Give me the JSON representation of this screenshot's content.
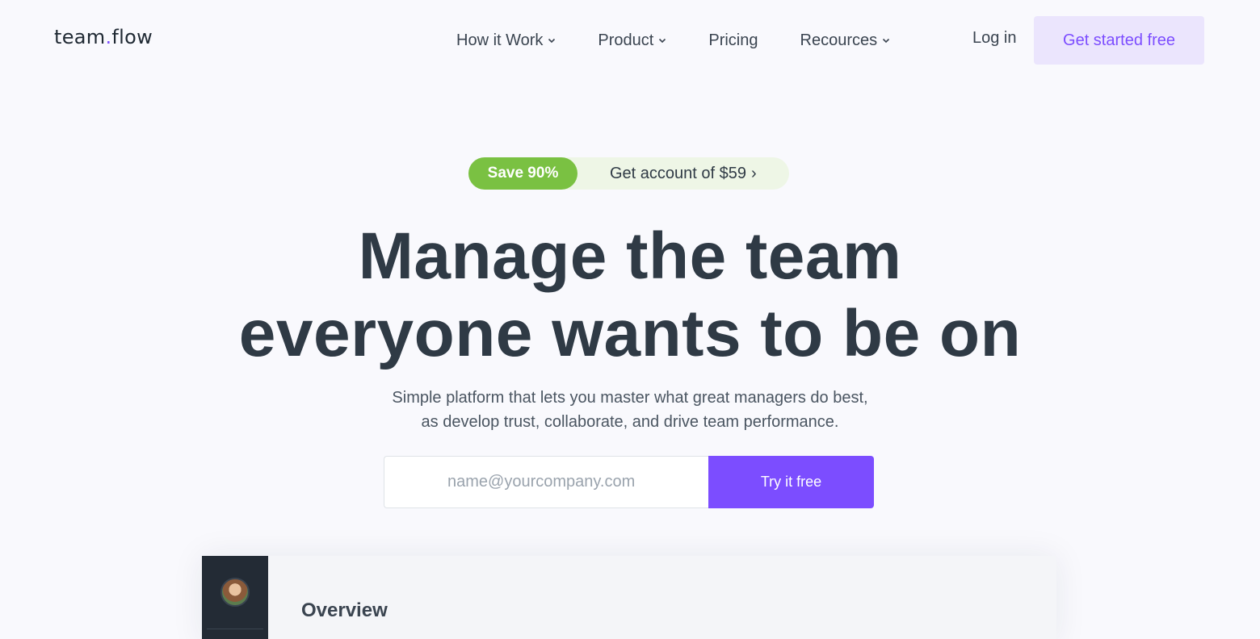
{
  "header": {
    "logo": {
      "left": "team",
      "dot": ".",
      "right": "flow"
    },
    "nav": [
      {
        "label": "How it Work",
        "has_dropdown": true
      },
      {
        "label": "Product",
        "has_dropdown": true
      },
      {
        "label": "Pricing",
        "has_dropdown": false
      },
      {
        "label": "Recources",
        "has_dropdown": true
      }
    ],
    "login_label": "Log in",
    "cta_label": "Get started free"
  },
  "promo": {
    "badge": "Save 90%",
    "text": "Get account of $59",
    "arrow": "›"
  },
  "hero": {
    "title_line1": "Manage the team",
    "title_line2": "everyone wants to be on",
    "subtitle_line1": "Simple platform that lets you master what great managers do best,",
    "subtitle_line2": "as develop trust, collaborate, and drive team performance."
  },
  "signup": {
    "email_placeholder": "name@yourcompany.com",
    "email_value": "",
    "button_label": "Try it free"
  },
  "preview": {
    "section_title": "Overview"
  },
  "colors": {
    "accent": "#7c4dff",
    "accent_light": "#ebe5fd",
    "promo_green": "#7ac142",
    "text_dark": "#2f3a45",
    "sidebar_dark": "#232b35"
  },
  "icons": {
    "dropdown": "chevron-down-icon",
    "promo_arrow": "chevron-right-icon"
  }
}
